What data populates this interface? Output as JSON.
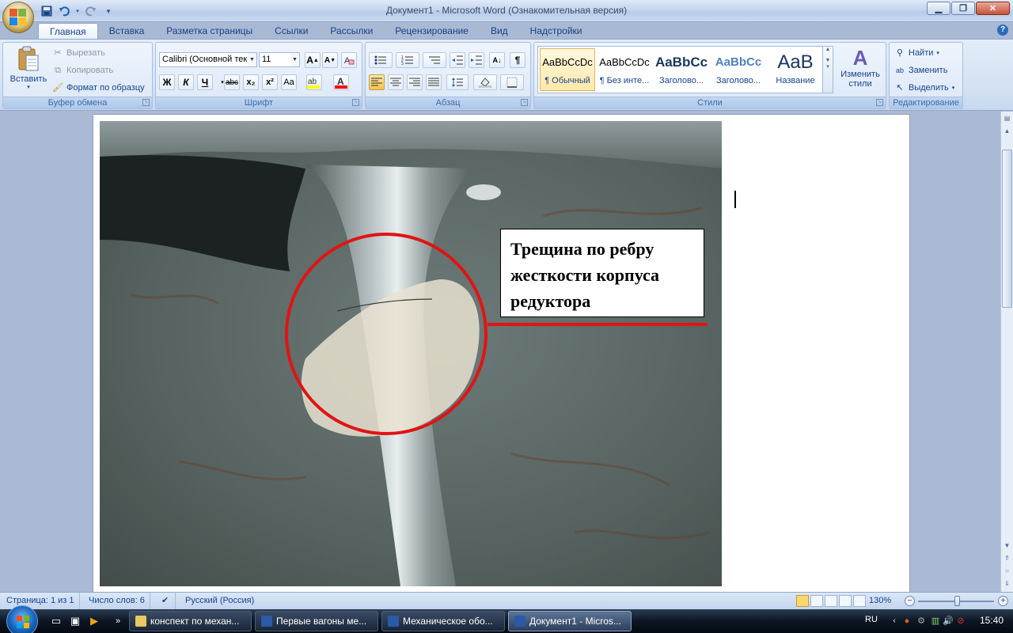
{
  "window": {
    "title": "Документ1 - Microsoft Word (Ознакомительная версия)"
  },
  "qat": {
    "save_icon": "save-icon",
    "undo_icon": "undo-icon",
    "redo_icon": "redo-icon"
  },
  "tabs": [
    {
      "label": "Главная",
      "active": true
    },
    {
      "label": "Вставка"
    },
    {
      "label": "Разметка страницы"
    },
    {
      "label": "Ссылки"
    },
    {
      "label": "Рассылки"
    },
    {
      "label": "Рецензирование"
    },
    {
      "label": "Вид"
    },
    {
      "label": "Надстройки"
    }
  ],
  "ribbon": {
    "clipboard": {
      "label": "Буфер обмена",
      "paste": "Вставить",
      "cut": "Вырезать",
      "copy": "Копировать",
      "format_painter": "Формат по образцу"
    },
    "font": {
      "label": "Шрифт",
      "font_name": "Calibri (Основной текст)",
      "font_size": "11",
      "bold": "Ж",
      "italic": "К",
      "underline": "Ч",
      "strike": "abc",
      "subscript": "x₂",
      "superscript": "x²",
      "change_case": "Aa"
    },
    "paragraph": {
      "label": "Абзац"
    },
    "styles": {
      "label": "Стили",
      "items": [
        {
          "sample": "AaBbCcDc",
          "name": "¶ Обычный"
        },
        {
          "sample": "AaBbCcDc",
          "name": "¶ Без инте..."
        },
        {
          "sample": "AaBbCc",
          "name": "Заголово..."
        },
        {
          "sample": "AaBbCc",
          "name": "Заголово..."
        },
        {
          "sample": "AaB",
          "name": "Название"
        }
      ],
      "change_styles": "Изменить стили"
    },
    "editing": {
      "label": "Редактирование",
      "find": "Найти",
      "replace": "Заменить",
      "select": "Выделить"
    }
  },
  "document": {
    "callout_text": "Трещина по ребру жесткости корпуса редуктора",
    "accent_color": "#e01414"
  },
  "status": {
    "page": "Страница: 1 из 1",
    "words": "Число слов: 6",
    "language": "Русский (Россия)",
    "zoom": "130%",
    "zoom_percent": 130
  },
  "taskbar": {
    "tasks": [
      {
        "label": "конспект по механ..."
      },
      {
        "label": "Первые вагоны ме..."
      },
      {
        "label": "Механическое обо..."
      },
      {
        "label": "Документ1 - Micros...",
        "active": true
      }
    ],
    "lang": "RU",
    "clock": "15:40"
  }
}
